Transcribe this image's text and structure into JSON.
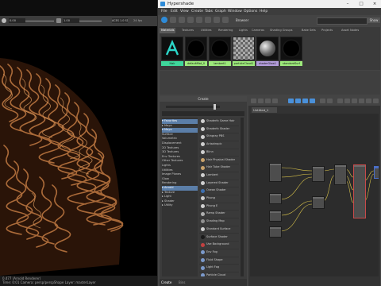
{
  "viewport": {
    "toolbar": {
      "field1": "0.00",
      "field2": "1.00",
      "color_mgmt": "ACES 1.0 SDR-video",
      "fps": "24 fps"
    },
    "status": {
      "line1": "0.477    (Arnold Renderer)",
      "line2": "Time: 0:01   Camera: persp/perspShape   Layer: masterLayer"
    }
  },
  "hypershade": {
    "title": "Hypershade",
    "menu": [
      "File",
      "Edit",
      "View",
      "Create",
      "Tabs",
      "Graph",
      "Window",
      "Options",
      "Help"
    ],
    "browser": {
      "title": "Browser",
      "search_placeholder": "",
      "show_label": "Show"
    },
    "tabs": [
      "Materials",
      "Textures",
      "Utilities",
      "Rendering",
      "Lights",
      "Cameras",
      "Shading Groups",
      "Bake Sets",
      "Projects",
      "Asset Nodes"
    ],
    "swatches": [
      {
        "label": "Hair",
        "icon": "arnold-logo-icon",
        "label_color": "#3fd79b"
      },
      {
        "label": "defaultMat_0",
        "icon": "black-sphere-icon",
        "label_color": "#9de97b"
      },
      {
        "label": "lambert1",
        "icon": "black-sphere-icon",
        "label_color": "#9de97b"
      },
      {
        "label": "particleCloud1",
        "icon": "checker-icon",
        "label_color": "#9de97b"
      },
      {
        "label": "shaderGlow1",
        "icon": "grey-sphere-icon",
        "label_color": "#b39ddb"
      },
      {
        "label": "standardSurf",
        "icon": "black-sphere-icon",
        "label_color": "#9de97b"
      }
    ],
    "create": {
      "title": "Create",
      "tree": [
        {
          "label": "▾ Favorites",
          "hl": true
        },
        {
          "label": "  ▸ Maya",
          "hl": false
        },
        {
          "label": "  ▾ Maya",
          "hl": true
        },
        {
          "label": "     Surface",
          "hl": false
        },
        {
          "label": "     Volumetric",
          "hl": false
        },
        {
          "label": "     Displacement",
          "hl": false
        },
        {
          "label": "     2D Textures",
          "hl": false
        },
        {
          "label": "     3D Textures",
          "hl": false
        },
        {
          "label": "     Env Textures",
          "hl": false
        },
        {
          "label": "     Other Textures",
          "hl": false
        },
        {
          "label": "     Lights",
          "hl": false
        },
        {
          "label": "     Utilities",
          "hl": false
        },
        {
          "label": "     Image Planes",
          "hl": false
        },
        {
          "label": "     Glow",
          "hl": false
        },
        {
          "label": "     Rendering",
          "hl": false
        },
        {
          "label": "▾ Arnold",
          "hl": true
        },
        {
          "label": "  ▸ Texture",
          "hl": false
        },
        {
          "label": "  ▸ Light",
          "hl": false
        },
        {
          "label": "  ▸ Shader",
          "hl": false
        },
        {
          "label": "  ▸ Utility",
          "hl": false
        }
      ],
      "shaders": [
        {
          "label": "Shaderfx Game Hair",
          "color": "#d0d0d0"
        },
        {
          "label": "Shaderfx Shader",
          "color": "#d0d0d0"
        },
        {
          "label": "Stingray PBS",
          "color": "#d0d0d0"
        },
        {
          "label": "Anisotropic",
          "color": "#d0d0d0"
        },
        {
          "label": "Blinn",
          "color": "#d0d0d0"
        },
        {
          "label": "Hair Physical Shader",
          "color": "#c9a26b"
        },
        {
          "label": "Hair Tube Shader",
          "color": "#c9a26b"
        },
        {
          "label": "Lambert",
          "color": "#d0d0d0"
        },
        {
          "label": "Layered Shader",
          "color": "#d0d0d0"
        },
        {
          "label": "Ocean Shader",
          "color": "#3d6fb0"
        },
        {
          "label": "Phong",
          "color": "#d0d0d0"
        },
        {
          "label": "Phong E",
          "color": "#d0d0d0"
        },
        {
          "label": "Ramp Shader",
          "color": "#b0b0b0"
        },
        {
          "label": "Shading Map",
          "color": "#909090"
        },
        {
          "label": "Standard Surface",
          "color": "#d0d0d0"
        },
        {
          "label": "Surface Shader",
          "color": "#1a1a1a"
        },
        {
          "label": "Use Background",
          "color": "#c24040"
        },
        {
          "label": "Env Fog",
          "color": "#7c9acb"
        },
        {
          "label": "Fluid Shape",
          "color": "#7c9acb"
        },
        {
          "label": "Light Fog",
          "color": "#7c9acb"
        },
        {
          "label": "Particle Cloud",
          "color": "#7c9acb"
        },
        {
          "label": "Volume Fog",
          "color": "#7c9acb"
        },
        {
          "label": "Volume Shader",
          "color": "#1a1a1a"
        }
      ]
    },
    "graph": {
      "tab_label": "Untitled_1"
    },
    "bottom_tabs": [
      "Create",
      "Bins"
    ]
  }
}
